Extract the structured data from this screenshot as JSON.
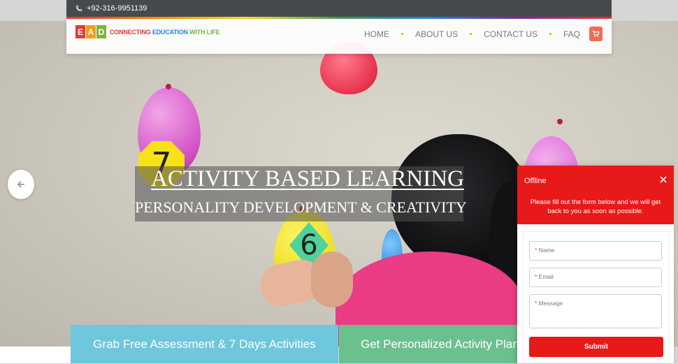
{
  "topbar": {
    "phone": "+92-316-9951139",
    "phone_icon": "phone-icon"
  },
  "header": {
    "logo_letters": [
      "E",
      "A",
      "D"
    ],
    "tagline_parts": [
      "CONNECTING ",
      "EDUCATION ",
      "WITH LIFE"
    ],
    "nav": [
      {
        "label": "HOME"
      },
      {
        "label": "ABOUT US"
      },
      {
        "label": "CONTACT US"
      },
      {
        "label": "FAQ"
      }
    ],
    "cart_icon": "cart-icon"
  },
  "hero": {
    "balloon_tag_1": "7",
    "balloon_tag_2": "6",
    "title": "ACTIVITY BASED LEARNING",
    "subtitle": "PERSONALITY DEVELOPMENT & CREATIVITY",
    "prev_icon": "arrow-left-icon"
  },
  "cta": {
    "left": "Grab Free Assessment & 7 Days Activities",
    "right": "Get Personalized Activity Plans"
  },
  "chat": {
    "status": "Offline",
    "message": "Please fill out the form below and we will get back to you as soon as possible.",
    "name_placeholder": "* Name",
    "email_placeholder": "* Email",
    "message_placeholder": "* Message",
    "submit": "Submit"
  },
  "colors": {
    "topbar": "#444a4e",
    "accent_red": "#e81919",
    "cta_blue": "#6ec7dd",
    "cta_green": "#6cc08e",
    "cart": "#ef6c54"
  }
}
